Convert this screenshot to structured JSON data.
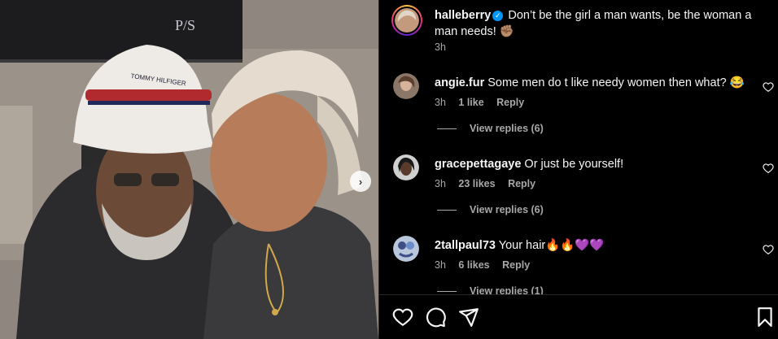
{
  "post": {
    "carousel_next": "›",
    "author": {
      "username": "halleberry",
      "verified_mark": "✓",
      "caption": "Don’t be the girl a man wants, be the woman a man needs! ✊🏽",
      "time": "3h"
    },
    "comments": [
      {
        "username": "angie.fur",
        "text": "Some men do t like needy women then what? 😂",
        "time": "3h",
        "likes": "1 like",
        "reply": "Reply",
        "view_replies": "View replies (6)"
      },
      {
        "username": "gracepettagaye",
        "text": "Or just be yourself!",
        "time": "3h",
        "likes": "23 likes",
        "reply": "Reply",
        "view_replies": "View replies (6)"
      },
      {
        "username": "2tallpaul73",
        "text": "Your hair🔥🔥💜💜",
        "time": "3h",
        "likes": "6 likes",
        "reply": "Reply",
        "view_replies": "View replies (1)"
      }
    ]
  },
  "icons": {
    "like": "heart-icon",
    "comment": "comment-icon",
    "share": "share-icon",
    "save": "bookmark-icon"
  },
  "colors": {
    "background": "#000000",
    "text": "#f5f5f5",
    "muted": "#a8a8a8",
    "verified": "#0095f6"
  }
}
